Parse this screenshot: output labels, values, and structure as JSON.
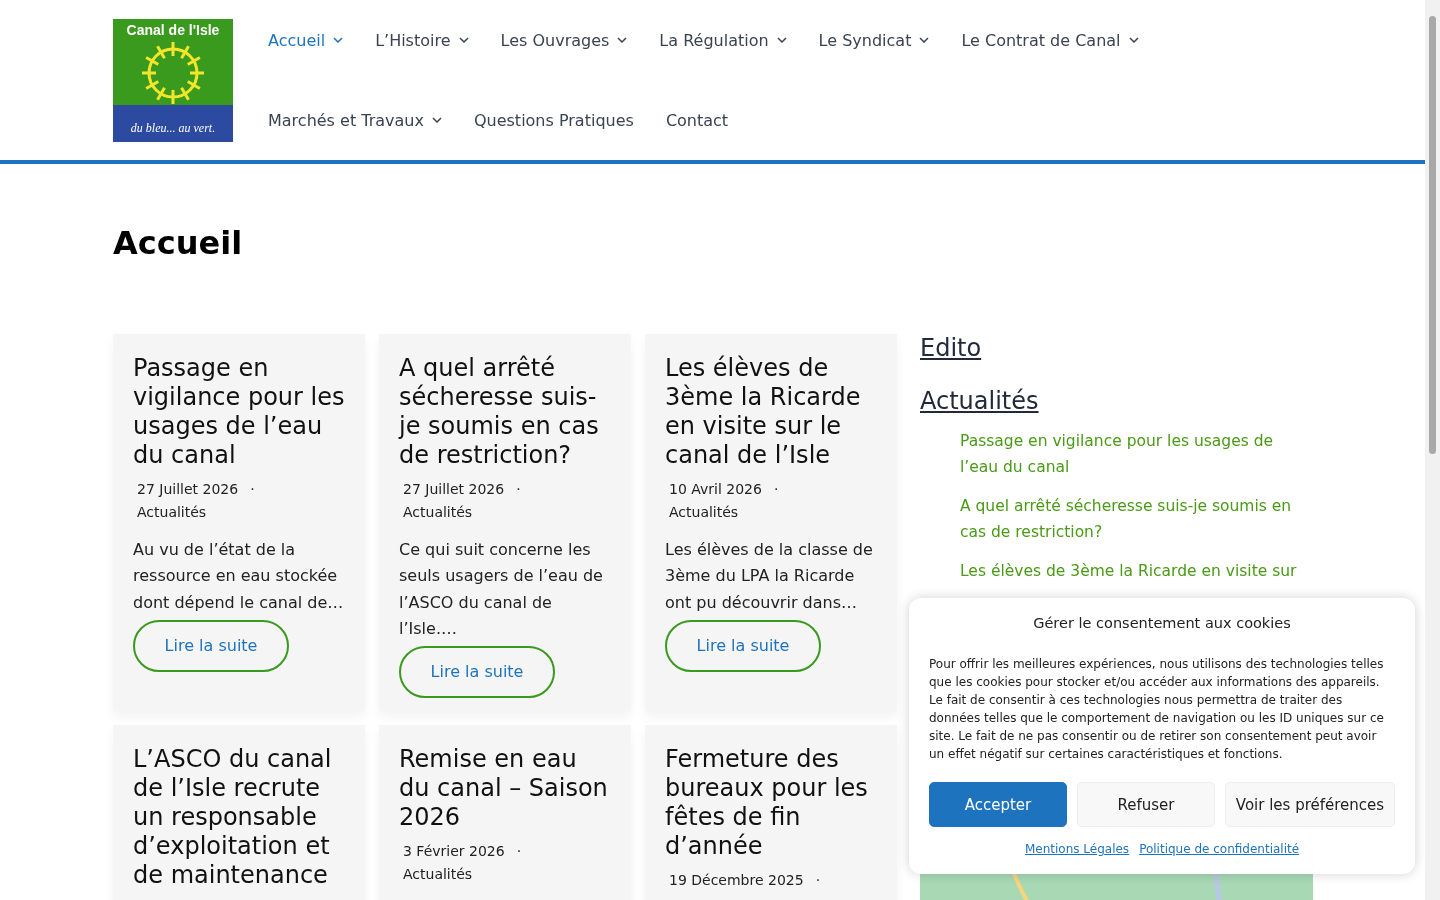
{
  "logo": {
    "title": "Canal de l'Isle",
    "tagline": "du bleu... au vert."
  },
  "nav": [
    {
      "label": "Accueil",
      "selected": true,
      "has_submenu": true
    },
    {
      "label": "L’Histoire",
      "selected": false,
      "has_submenu": true
    },
    {
      "label": "Les Ouvrages",
      "selected": false,
      "has_submenu": true
    },
    {
      "label": "La Régulation",
      "selected": false,
      "has_submenu": true
    },
    {
      "label": "Le Syndicat",
      "selected": false,
      "has_submenu": true
    },
    {
      "label": "Le Contrat de Canal",
      "selected": false,
      "has_submenu": true
    },
    {
      "label": "Marchés et Travaux",
      "selected": false,
      "has_submenu": true
    },
    {
      "label": "Questions Pratiques",
      "selected": false,
      "has_submenu": false
    },
    {
      "label": "Contact",
      "selected": false,
      "has_submenu": false
    }
  ],
  "page_title": "Accueil",
  "posts": [
    {
      "title": "Passage en vigilance pour les usages de l’eau du canal",
      "date": "27 Juillet 2026",
      "separator": "·",
      "category": "Actualités",
      "excerpt": "Au vu de l’état de la ressource en eau stockée dont dépend le canal de…",
      "button": "Lire la suite"
    },
    {
      "title": "A quel arrêté sécheresse suis-je soumis en cas de restriction?",
      "date": "27 Juillet 2026",
      "separator": "·",
      "category": "Actualités",
      "excerpt": "Ce qui suit concerne les seuls usagers de l’eau de l’ASCO du canal de l’Isle.…",
      "button": "Lire la suite"
    },
    {
      "title": "Les élèves de 3ème la Ricarde en visite sur le canal de l’Isle",
      "date": "10 Avril 2026",
      "separator": "·",
      "category": "Actualités",
      "excerpt": "Les élèves de la classe de 3ème du LPA la Ricarde ont pu découvrir dans…",
      "button": "Lire la suite"
    },
    {
      "title": "L’ASCO du canal de l’Isle recrute un responsable d’exploitation et de maintenance"
    },
    {
      "title": "Remise en eau du canal – Saison 2026",
      "date": "3 Février 2026",
      "separator": "·",
      "category": "Actualités"
    },
    {
      "title": "Fermeture des bureaux pour les fêtes de fin d’année",
      "date": "19 Décembre 2025",
      "separator": "·"
    }
  ],
  "sidebar": {
    "headings": [
      {
        "label": "Edito"
      },
      {
        "label": "Actualités",
        "links": [
          "Passage en vigilance pour les usages de l’eau du canal",
          "A quel arrêté sécheresse suis-je soumis en cas de restriction?",
          "Les élèves de 3ème la Ricarde en visite sur"
        ]
      }
    ]
  },
  "cookie_banner": {
    "title": "Gérer le consentement aux cookies",
    "text": "Pour offrir les meilleures expériences, nous utilisons des technologies telles que les cookies pour stocker et/ou accéder aux informations des appareils. Le fait de consentir à ces technologies nous permettra de traiter des données telles que le comportement de navigation ou les ID uniques sur ce site. Le fait de ne pas consentir ou de retirer son consentement peut avoir un effet négatif sur certaines caractéristiques et fonctions.",
    "buttons": [
      {
        "label": "Accepter",
        "kind": "primary"
      },
      {
        "label": "Refuser",
        "kind": "secondary"
      },
      {
        "label": "Voir les préférences",
        "kind": "secondary"
      }
    ],
    "links": [
      "Mentions Légales",
      "Politique de confidentialité"
    ]
  }
}
